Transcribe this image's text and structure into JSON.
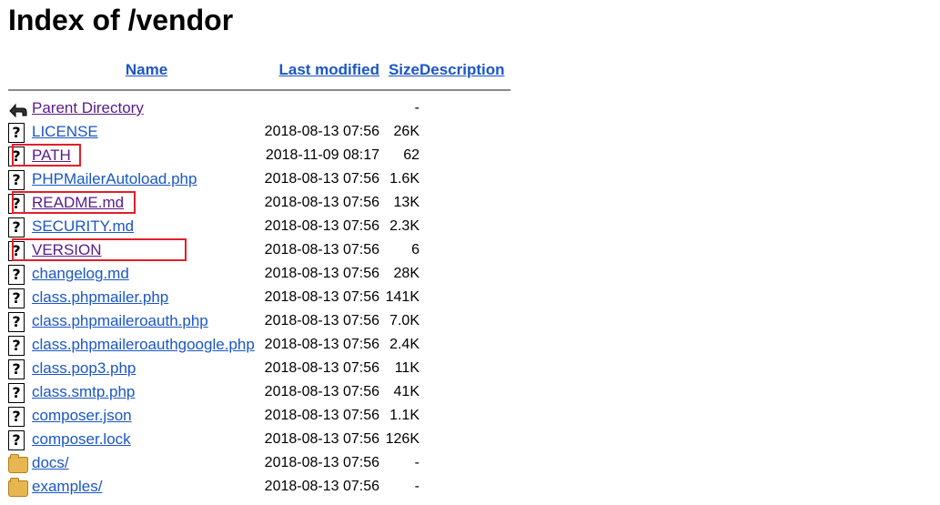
{
  "title": "Index of /vendor",
  "headers": {
    "name": "Name",
    "last_modified": "Last modified",
    "size": "Size",
    "description": "Description"
  },
  "rows": [
    {
      "name": "Parent Directory",
      "modified": "",
      "size": "-",
      "icon": "back-icon",
      "visited": true
    },
    {
      "name": "LICENSE",
      "modified": "2018-08-13 07:56",
      "size": "26K",
      "icon": "unknown-file-icon",
      "visited": false
    },
    {
      "name": "PATH",
      "modified": "2018-11-09 08:17",
      "size": "62",
      "icon": "unknown-file-icon",
      "visited": true
    },
    {
      "name": "PHPMailerAutoload.php",
      "modified": "2018-08-13 07:56",
      "size": "1.6K",
      "icon": "unknown-file-icon",
      "visited": false
    },
    {
      "name": "README.md",
      "modified": "2018-08-13 07:56",
      "size": "13K",
      "icon": "unknown-file-icon",
      "visited": true
    },
    {
      "name": "SECURITY.md",
      "modified": "2018-08-13 07:56",
      "size": "2.3K",
      "icon": "unknown-file-icon",
      "visited": false
    },
    {
      "name": "VERSION",
      "modified": "2018-08-13 07:56",
      "size": "6",
      "icon": "unknown-file-icon",
      "visited": true
    },
    {
      "name": "changelog.md",
      "modified": "2018-08-13 07:56",
      "size": "28K",
      "icon": "unknown-file-icon",
      "visited": false
    },
    {
      "name": "class.phpmailer.php",
      "modified": "2018-08-13 07:56",
      "size": "141K",
      "icon": "unknown-file-icon",
      "visited": false
    },
    {
      "name": "class.phpmaileroauth.php",
      "modified": "2018-08-13 07:56",
      "size": "7.0K",
      "icon": "unknown-file-icon",
      "visited": false
    },
    {
      "name": "class.phpmaileroauthgoogle.php",
      "modified": "2018-08-13 07:56",
      "size": "2.4K",
      "icon": "unknown-file-icon",
      "visited": false
    },
    {
      "name": "class.pop3.php",
      "modified": "2018-08-13 07:56",
      "size": "11K",
      "icon": "unknown-file-icon",
      "visited": false
    },
    {
      "name": "class.smtp.php",
      "modified": "2018-08-13 07:56",
      "size": "41K",
      "icon": "unknown-file-icon",
      "visited": false
    },
    {
      "name": "composer.json",
      "modified": "2018-08-13 07:56",
      "size": "1.1K",
      "icon": "unknown-file-icon",
      "visited": false
    },
    {
      "name": "composer.lock",
      "modified": "2018-08-13 07:56",
      "size": "126K",
      "icon": "unknown-file-icon",
      "visited": false
    },
    {
      "name": "docs/",
      "modified": "2018-08-13 07:56",
      "size": "-",
      "icon": "folder-icon",
      "visited": false
    },
    {
      "name": "examples/",
      "modified": "2018-08-13 07:56",
      "size": "-",
      "icon": "folder-icon",
      "visited": false
    }
  ],
  "highlight_color": "#e0202a",
  "link_color": "#1a56c5",
  "visited_link_color": "#5a1a8a",
  "highlighted_rows": [
    "PATH",
    "README.md",
    "VERSION"
  ]
}
